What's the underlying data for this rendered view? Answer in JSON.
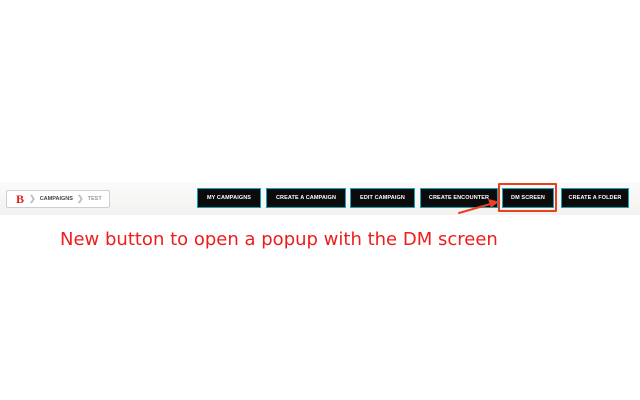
{
  "breadcrumb": {
    "logo": "B",
    "separator": "❯",
    "items": [
      "CAMPAIGNS",
      "TEST"
    ]
  },
  "toolbar": {
    "buttons": [
      {
        "label": "MY CAMPAIGNS"
      },
      {
        "label": "CREATE A CAMPAIGN"
      },
      {
        "label": "EDIT CAMPAIGN"
      },
      {
        "label": "CREATE ENCOUNTER"
      },
      {
        "label": "DM SCREEN"
      },
      {
        "label": "CREATE A FOLDER"
      }
    ]
  },
  "annotation": {
    "text": "New button to open a popup with the DM screen",
    "color": "#ee1c1c",
    "highlight_color": "#e8411f"
  },
  "colors": {
    "button_bg": "#0b0b0b",
    "button_border": "#16a3b4",
    "logo": "#e0211d"
  }
}
